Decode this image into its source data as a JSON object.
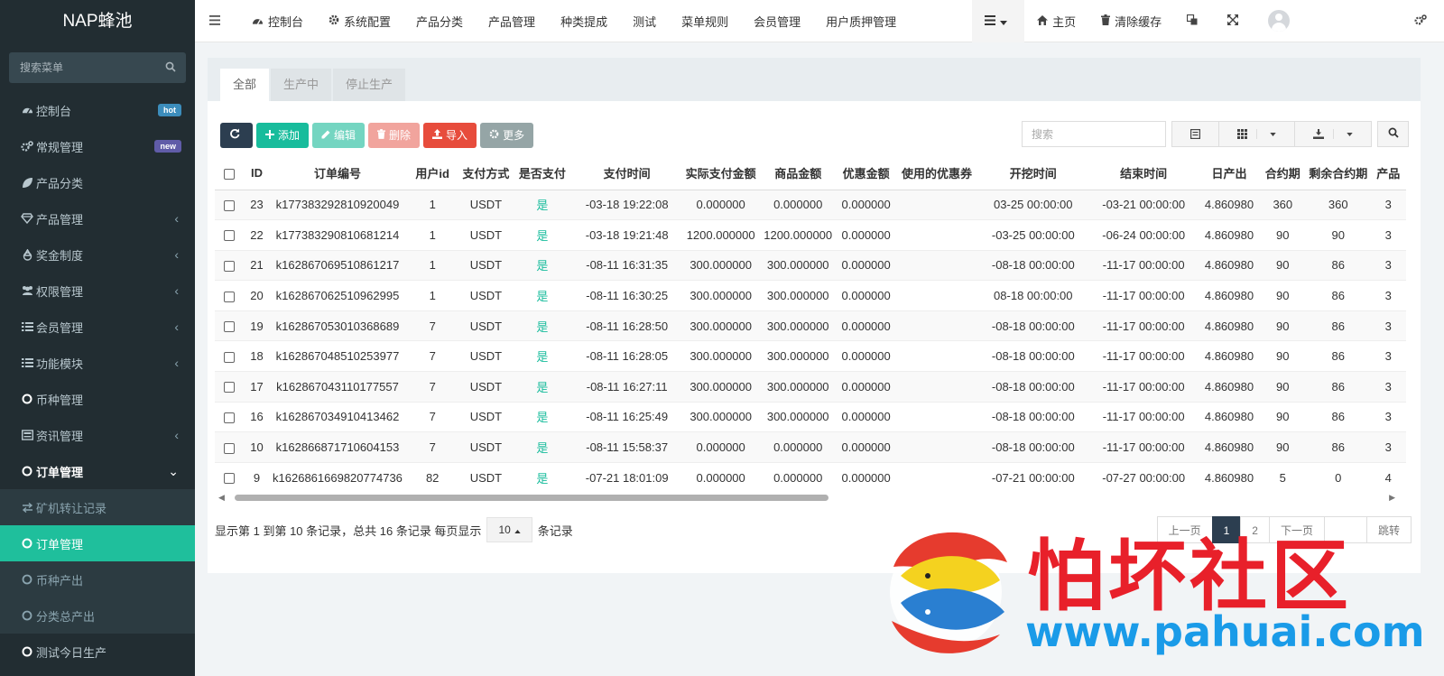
{
  "brand": "NAP蜂池",
  "sidebar": {
    "search_placeholder": "搜索菜单",
    "items": [
      {
        "label": "控制台",
        "icon": "dashboard-icon",
        "badge": "hot",
        "badge_color": "#3c8dbc"
      },
      {
        "label": "常规管理",
        "icon": "cogs-icon",
        "badge": "new",
        "badge_color": "#605ca8"
      },
      {
        "label": "产品分类",
        "icon": "leaf-icon"
      },
      {
        "label": "产品管理",
        "icon": "diamond-icon",
        "caret": "‹"
      },
      {
        "label": "奖金制度",
        "icon": "recycle-icon",
        "caret": "‹"
      },
      {
        "label": "权限管理",
        "icon": "group-icon",
        "caret": "‹"
      },
      {
        "label": "会员管理",
        "icon": "list-icon",
        "caret": "‹"
      },
      {
        "label": "功能模块",
        "icon": "list-icon",
        "caret": "‹"
      },
      {
        "label": "币种管理",
        "icon": "circle-icon"
      },
      {
        "label": "资讯管理",
        "icon": "newspaper-icon",
        "caret": "‹"
      },
      {
        "label": "订单管理",
        "icon": "circle-icon",
        "caret": "⌄"
      },
      {
        "label": "矿机转让记录",
        "icon": "exchange-icon"
      },
      {
        "label": "订单管理",
        "icon": "circle-icon"
      },
      {
        "label": "币种产出",
        "icon": "circle-icon"
      },
      {
        "label": "分类总产出",
        "icon": "circle-icon"
      },
      {
        "label": "测试今日生产",
        "icon": "circle-icon"
      }
    ]
  },
  "topbar": {
    "nav": [
      {
        "label": "控制台",
        "icon": "dashboard-icon"
      },
      {
        "label": "系统配置",
        "icon": "gear-icon"
      },
      {
        "label": "产品分类"
      },
      {
        "label": "产品管理"
      },
      {
        "label": "种类提成"
      },
      {
        "label": "测试"
      },
      {
        "label": "菜单规则"
      },
      {
        "label": "会员管理"
      },
      {
        "label": "用户质押管理"
      }
    ],
    "home": "主页",
    "clear_cache": "清除缓存"
  },
  "tabs": [
    "全部",
    "生产中",
    "停止生产"
  ],
  "toolbar": {
    "add": "添加",
    "edit": "编辑",
    "delete": "删除",
    "import": "导入",
    "more": "更多"
  },
  "search_placeholder": "搜索",
  "table": {
    "columns": [
      "ID",
      "订单编号",
      "用户id",
      "支付方式",
      "是否支付",
      "支付时间",
      "实际支付金额",
      "商品金额",
      "优惠金额",
      "使用的优惠券",
      "开挖时间",
      "结束时间",
      "日产出",
      "合约期",
      "剩余合约期",
      "产品"
    ],
    "rows": [
      [
        "23",
        "k177383292810920049",
        "1",
        "USDT",
        "是",
        "-03-18 19:22:08",
        "0.000000",
        "0.000000",
        "0.000000",
        "",
        "03-25 00:00:00",
        "-03-21 00:00:00",
        "4.860980",
        "360",
        "360",
        "3"
      ],
      [
        "22",
        "k177383290810681214",
        "1",
        "USDT",
        "是",
        "-03-18 19:21:48",
        "1200.000000",
        "1200.000000",
        "0.000000",
        "",
        "-03-25 00:00:00",
        "-06-24 00:00:00",
        "4.860980",
        "90",
        "90",
        "3"
      ],
      [
        "21",
        "k162867069510861217",
        "1",
        "USDT",
        "是",
        "-08-11 16:31:35",
        "300.000000",
        "300.000000",
        "0.000000",
        "",
        "-08-18 00:00:00",
        "-11-17 00:00:00",
        "4.860980",
        "90",
        "86",
        "3"
      ],
      [
        "20",
        "k162867062510962995",
        "1",
        "USDT",
        "是",
        "-08-11 16:30:25",
        "300.000000",
        "300.000000",
        "0.000000",
        "",
        "08-18 00:00:00",
        "-11-17 00:00:00",
        "4.860980",
        "90",
        "86",
        "3"
      ],
      [
        "19",
        "k162867053010368689",
        "7",
        "USDT",
        "是",
        "-08-11 16:28:50",
        "300.000000",
        "300.000000",
        "0.000000",
        "",
        "-08-18 00:00:00",
        "-11-17 00:00:00",
        "4.860980",
        "90",
        "86",
        "3"
      ],
      [
        "18",
        "k162867048510253977",
        "7",
        "USDT",
        "是",
        "-08-11 16:28:05",
        "300.000000",
        "300.000000",
        "0.000000",
        "",
        "-08-18 00:00:00",
        "-11-17 00:00:00",
        "4.860980",
        "90",
        "86",
        "3"
      ],
      [
        "17",
        "k162867043110177557",
        "7",
        "USDT",
        "是",
        "-08-11 16:27:11",
        "300.000000",
        "300.000000",
        "0.000000",
        "",
        "-08-18 00:00:00",
        "-11-17 00:00:00",
        "4.860980",
        "90",
        "86",
        "3"
      ],
      [
        "16",
        "k162867034910413462",
        "7",
        "USDT",
        "是",
        "-08-11 16:25:49",
        "300.000000",
        "300.000000",
        "0.000000",
        "",
        "-08-18 00:00:00",
        "-11-17 00:00:00",
        "4.860980",
        "90",
        "86",
        "3"
      ],
      [
        "10",
        "k162866871710604153",
        "7",
        "USDT",
        "是",
        "-08-11 15:58:37",
        "0.000000",
        "0.000000",
        "0.000000",
        "",
        "-08-18 00:00:00",
        "-11-17 00:00:00",
        "4.860980",
        "90",
        "86",
        "3"
      ],
      [
        "9",
        "k1626861669820774736",
        "82",
        "USDT",
        "是",
        "-07-21 18:01:09",
        "0.000000",
        "0.000000",
        "0.000000",
        "",
        "-07-21 00:00:00",
        "-07-27 00:00:00",
        "4.860980",
        "5",
        "0",
        "4"
      ]
    ]
  },
  "footer": {
    "info": "显示第 1 到第 10 条记录，总共 16 条记录 每页显示",
    "page_size": "10",
    "suffix": "条记录",
    "prev": "上一页",
    "page1": "1",
    "page2": "2",
    "next": "下一页",
    "jump": "跳转"
  },
  "watermark": {
    "title": "怕坏社区",
    "url": "www.pahuai.com"
  },
  "colors": {
    "sidebar_bg": "#222d32",
    "active": "#1fbf9c",
    "paid": "#18bc9c"
  }
}
